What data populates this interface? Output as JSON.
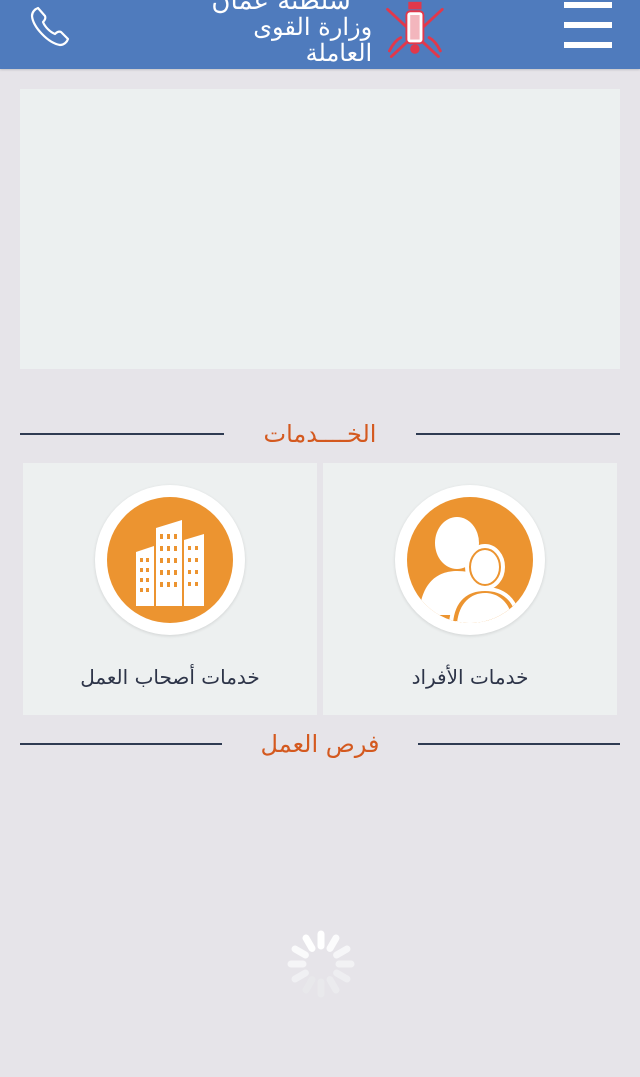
{
  "header": {
    "logo_line1": "سلطنة عمان",
    "logo_line2": "وزارة القوى العاملة",
    "phone_icon": "phone-icon",
    "menu_icon": "hamburger-menu-icon",
    "emblem_icon": "oman-emblem-icon",
    "color": "#4f7bbd"
  },
  "services": {
    "title": "الخــــدمات",
    "cards": [
      {
        "label": "خدمات أصحاب العمل",
        "icon": "buildings-icon"
      },
      {
        "label": "خدمات الأفراد",
        "icon": "people-icon"
      }
    ]
  },
  "jobs": {
    "title": "فرص العمل"
  },
  "colors": {
    "accent": "#d4591f",
    "icon_fill": "#ec9430",
    "background": "#e6e4e9",
    "card": "#edf0f0"
  }
}
